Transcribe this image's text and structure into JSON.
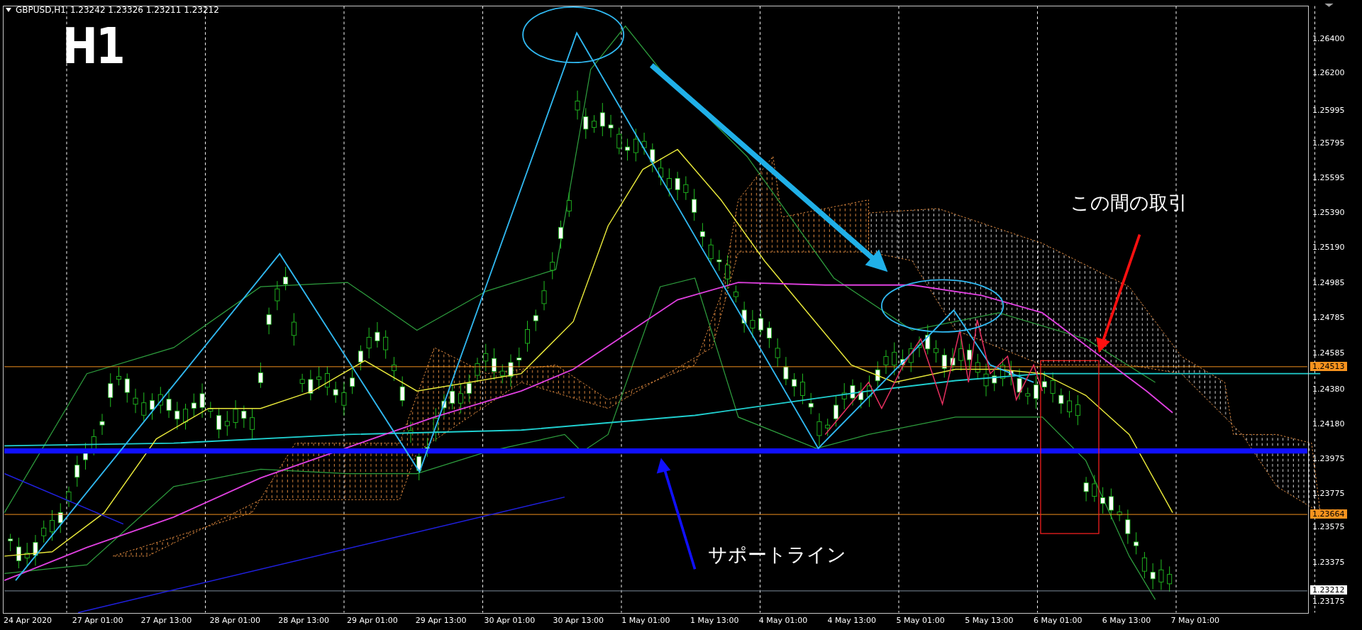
{
  "symbol": {
    "title": "GBPUSD,H1",
    "ohlc": "1.23242 1.23326 1.23211 1.23212"
  },
  "timeframe_label": "H1",
  "annotations": [
    {
      "text": "この間の取引"
    },
    {
      "text": "サポートライン"
    }
  ],
  "price_axis": [
    {
      "label": "1.26400",
      "kind": "tick"
    },
    {
      "label": "1.26200",
      "kind": "tick"
    },
    {
      "label": "1.25995",
      "kind": "tick"
    },
    {
      "label": "1.25795",
      "kind": "tick"
    },
    {
      "label": "1.25595",
      "kind": "tick"
    },
    {
      "label": "1.25390",
      "kind": "tick"
    },
    {
      "label": "1.25190",
      "kind": "tick"
    },
    {
      "label": "1.24985",
      "kind": "tick"
    },
    {
      "label": "1.24785",
      "kind": "tick"
    },
    {
      "label": "1.24585",
      "kind": "tick"
    },
    {
      "label": "1.24513",
      "kind": "marker",
      "color": "#f7931e"
    },
    {
      "label": "1.24380",
      "kind": "tick"
    },
    {
      "label": "1.24180",
      "kind": "tick"
    },
    {
      "label": "1.23975",
      "kind": "tick"
    },
    {
      "label": "1.23775",
      "kind": "tick"
    },
    {
      "label": "1.23664",
      "kind": "marker",
      "color": "#f7931e"
    },
    {
      "label": "1.23575",
      "kind": "tick"
    },
    {
      "label": "1.23375",
      "kind": "tick"
    },
    {
      "label": "1.23212",
      "kind": "marker",
      "color": "#ffffff"
    },
    {
      "label": "1.23175",
      "kind": "tick"
    }
  ],
  "time_axis": [
    "24 Apr 2020",
    "27 Apr 01:00",
    "27 Apr 13:00",
    "28 Apr 01:00",
    "28 Apr 13:00",
    "29 Apr 01:00",
    "29 Apr 13:00",
    "30 Apr 01:00",
    "30 Apr 13:00",
    "1 May 01:00",
    "1 May 13:00",
    "4 May 01:00",
    "4 May 13:00",
    "5 May 01:00",
    "5 May 13:00",
    "6 May 01:00",
    "6 May 13:00",
    "7 May 01:00"
  ]
}
